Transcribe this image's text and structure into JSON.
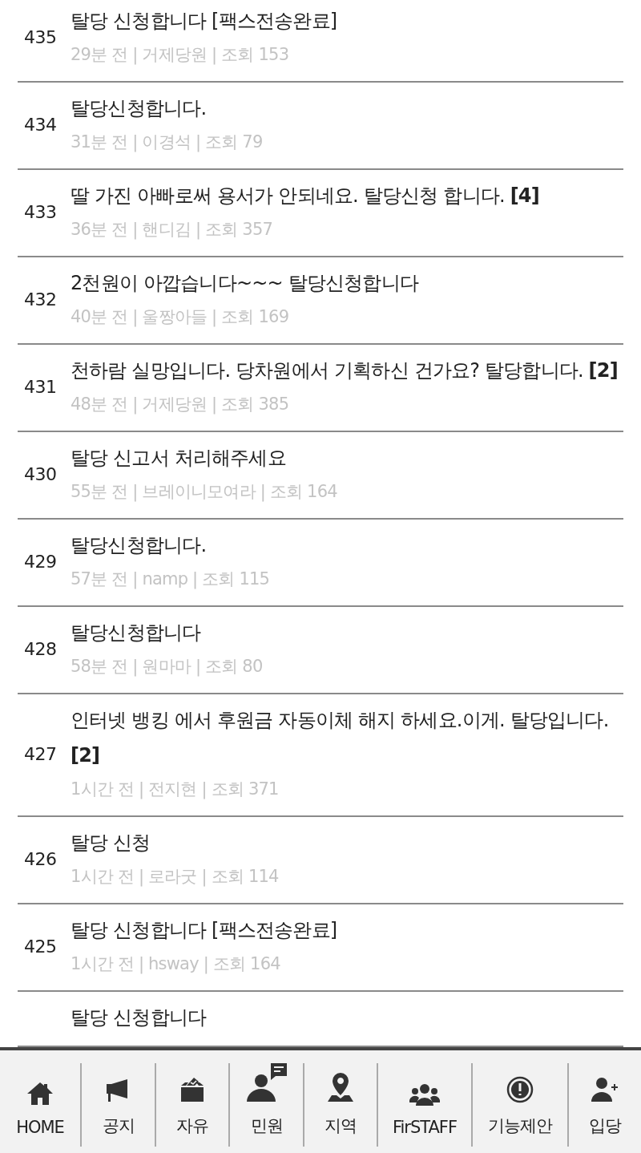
{
  "posts": [
    {
      "number": "435",
      "title": "탈당 신청합니다 [팩스전송완료]",
      "meta": "29분 전 | 거제당원 | 조회 153"
    },
    {
      "number": "434",
      "title": "탈당신청합니다.",
      "meta": "31분 전 | 이경석 | 조회 79"
    },
    {
      "number": "433",
      "title": "딸 가진 아빠로써 용서가 안되네요. 탈당신청 합니다. **[4]**",
      "meta": "36분 전 | 핸디김 | 조회 357"
    },
    {
      "number": "432",
      "title": "2천원이 아깝습니다~~~ 탈당신청합니다",
      "meta": "40분 전 | 울짱아들 | 조회 169"
    },
    {
      "number": "431",
      "title": "천하람 실망입니다. 당차원에서 기획하신 건가요? 탈당합니다. **[2]**",
      "meta": "48분 전 | 거제당원 | 조회 385"
    },
    {
      "number": "430",
      "title": "탈당 신고서 처리해주세요",
      "meta": "55분 전 | 브레이니모여라 | 조회 164"
    },
    {
      "number": "429",
      "title": "탈당신청합니다.",
      "meta": "57분 전 | namp | 조회 115"
    },
    {
      "number": "428",
      "title": "탈당신청합니다",
      "meta": "58분 전 | 원마마 | 조회 80"
    },
    {
      "number": "427",
      "title": "인터넷 뱅킹 에서 후원금 자동이체 해지 하세요.이게. 탈당입니다. **[2]**",
      "meta": "1시간 전 | 전지현 | 조회 371"
    },
    {
      "number": "426",
      "title": "탈당 신청",
      "meta": "1시간 전 | 로라굿 | 조회 114"
    },
    {
      "number": "425",
      "title": "탈당 신청합니다 [팩스전송완료]",
      "meta": "1시간 전 | hsway | 조회 164"
    },
    {
      "title": "탈당 신청합니다"
    }
  ],
  "nav": [
    {
      "label": "HOME"
    },
    {
      "label": "공지"
    },
    {
      "label": "자유"
    },
    {
      "label": "민원"
    },
    {
      "label": "지역"
    },
    {
      "label": "FirSTAFF"
    },
    {
      "label": "기능제안"
    },
    {
      "label": "입당"
    }
  ]
}
